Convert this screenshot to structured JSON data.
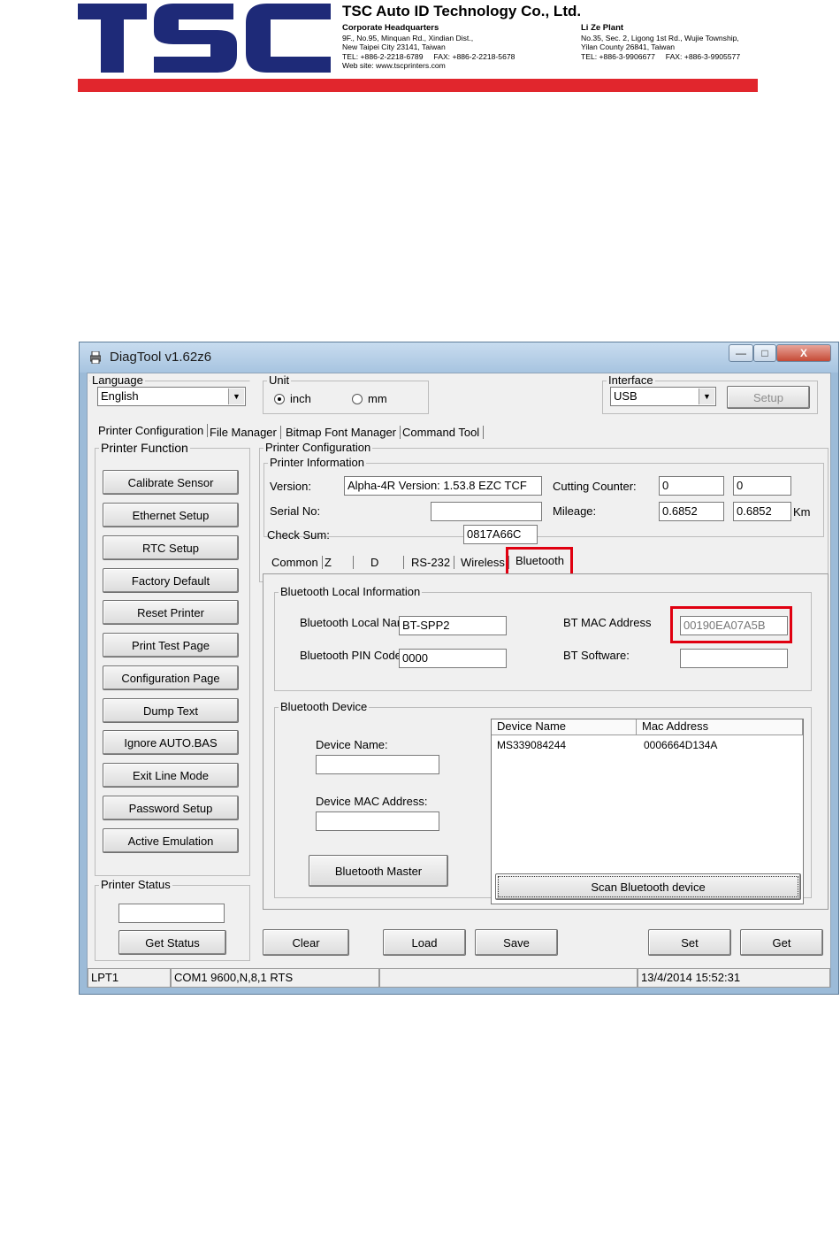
{
  "header": {
    "logo_text": "TSC",
    "company": "TSC Auto ID Technology Co., Ltd.",
    "hq": {
      "title": "Corporate Headquarters",
      "line1": "9F., No.95, Minquan Rd., Xindian Dist.,",
      "line2": "New Taipei City 23141, Taiwan",
      "line3": "TEL: +886-2-2218-6789     FAX: +886-2-2218-5678",
      "line4": "Web site: www.tscprinters.com"
    },
    "plant": {
      "title": "Li Ze Plant",
      "line1": "No.35, Sec. 2, Ligong 1st Rd., Wujie Township,",
      "line2": "Yilan County 26841, Taiwan",
      "line3": "TEL: +886-3-9906677     FAX: +886-3-9905577"
    },
    "colors": {
      "blue": "#1e2a78",
      "red": "#e1262d"
    }
  },
  "window": {
    "title": "DiagTool v1.62z6",
    "min": "—",
    "max": "□",
    "close": "X"
  },
  "top": {
    "language_label": "Language",
    "language_value": "English",
    "unit_label": "Unit",
    "unit_inch": "inch",
    "unit_mm": "mm",
    "interface_label": "Interface",
    "interface_value": "USB",
    "setup": "Setup"
  },
  "main_tabs": [
    "Printer Configuration",
    "File Manager",
    "Bitmap Font Manager",
    "Command Tool"
  ],
  "printer_function": {
    "label": "Printer Function",
    "buttons": [
      "Calibrate Sensor",
      "Ethernet Setup",
      "RTC Setup",
      "Factory Default",
      "Reset Printer",
      "Print Test Page",
      "Configuration Page",
      "Dump Text",
      "Ignore AUTO.BAS",
      "Exit Line Mode",
      "Password Setup",
      "Active Emulation"
    ]
  },
  "printer_status": {
    "label": "Printer Status",
    "value": "",
    "get_status": "Get Status"
  },
  "config": {
    "label": "Printer Configuration",
    "info_label": "Printer Information",
    "version_label": "Version:",
    "version_value": "Alpha-4R Version: 1.53.8 EZC TCF",
    "serial_label": "Serial No:",
    "serial_value": "",
    "checksum_label": "Check Sum:",
    "checksum_value": "0817A66C",
    "cutting_label": "Cutting Counter:",
    "cutting_1": "0",
    "cutting_2": "0",
    "mileage_label": "Mileage:",
    "mileage_1": "0.6852",
    "mileage_2": "0.6852",
    "km": "Km"
  },
  "sub_tabs": [
    "Common",
    "Z",
    "D",
    "RS-232",
    "Wireless",
    "Bluetooth"
  ],
  "bluetooth": {
    "local_label": "Bluetooth Local Information",
    "local_name_label": "Bluetooth Local Nan",
    "local_name_value": "BT-SPP2",
    "pin_label": "Bluetooth PIN Code",
    "pin_value": "0000",
    "mac_label": "BT MAC Address",
    "mac_value": "00190EA07A5B",
    "software_label": "BT Software:",
    "software_value": "",
    "device_label": "Bluetooth Device",
    "device_name_label": "Device Name:",
    "device_name_value": "",
    "device_mac_label": "Device MAC Address:",
    "device_mac_value": "",
    "master_button": "Bluetooth Master",
    "list_headers": [
      "Device Name",
      "Mac Address"
    ],
    "list_rows": [
      {
        "name": "MS339084244",
        "mac": "0006664D134A"
      }
    ],
    "scan_button": "Scan Bluetooth device"
  },
  "bottom_buttons": {
    "clear": "Clear",
    "load": "Load",
    "save": "Save",
    "set": "Set",
    "get": "Get"
  },
  "statusbar": {
    "port": "LPT1",
    "com": "COM1 9600,N,8,1 RTS",
    "middle": "",
    "datetime": "13/4/2014 15:52:31"
  },
  "highlight_color": "#e00010"
}
